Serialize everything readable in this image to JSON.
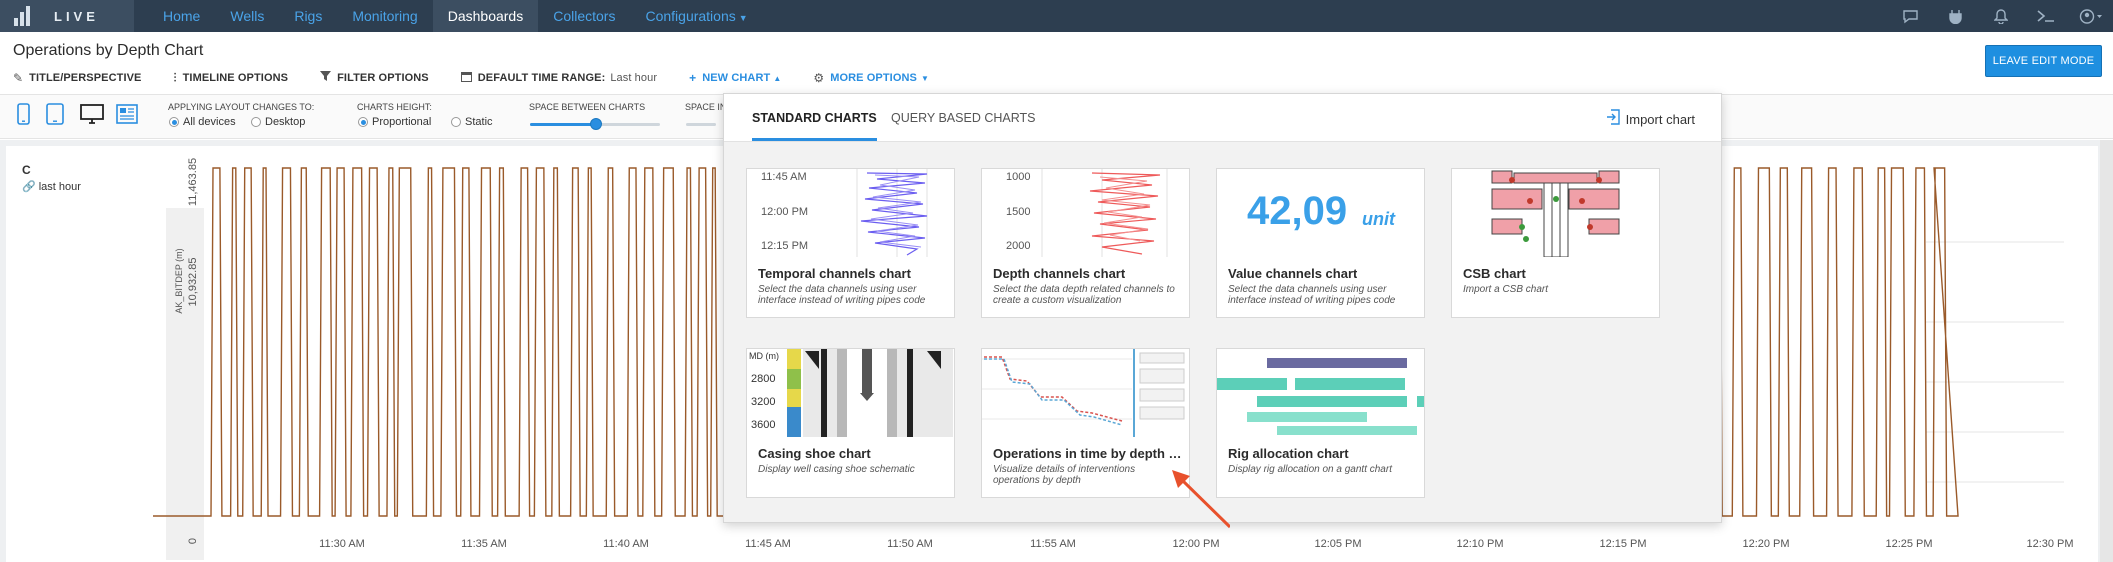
{
  "nav": {
    "brand": "LIVE",
    "items": [
      {
        "label": "Home"
      },
      {
        "label": "Wells"
      },
      {
        "label": "Rigs"
      },
      {
        "label": "Monitoring"
      },
      {
        "label": "Dashboards"
      },
      {
        "label": "Collectors"
      },
      {
        "label": "Configurations"
      }
    ],
    "right_icons": [
      "chat-icon",
      "plugin-icon",
      "bell-icon",
      "terminal-icon",
      "user-icon"
    ]
  },
  "page": {
    "title": "Operations by Depth Chart",
    "leave_button": "LEAVE EDIT MODE"
  },
  "toolbar": {
    "title_perspective": "TITLE/PERSPECTIVE",
    "timeline_options": "TIMELINE OPTIONS",
    "filter_options": "FILTER OPTIONS",
    "default_time_range": "DEFAULT TIME RANGE:",
    "default_time_value": "Last hour",
    "new_chart": "NEW CHART",
    "more_options": "MORE OPTIONS"
  },
  "layout": {
    "applying_label": "APPLYING LAYOUT CHANGES TO:",
    "all_devices": "All devices",
    "desktop": "Desktop",
    "charts_height": "CHARTS HEIGHT:",
    "proportional": "Proportional",
    "static": "Static",
    "space_between": "SPACE BETWEEN CHARTS",
    "space_in": "SPACE IN",
    "space_between_value": 0.5
  },
  "chart_panel": {
    "title": "C",
    "subtitle": "last hour"
  },
  "chart_data": {
    "type": "line",
    "title": "",
    "ylabel": "AK_BITDEP (m)",
    "y_ticks": [
      "0",
      "10,932.85",
      "11,463.85"
    ],
    "x_ticks": [
      "11:30 AM",
      "11:35 AM",
      "11:40 AM",
      "11:45 AM",
      "11:50 AM",
      "11:55 AM",
      "12:00 PM",
      "12:05 PM",
      "12:10 PM",
      "12:15 PM",
      "12:20 PM",
      "12:25 PM",
      "12:30 PM"
    ],
    "series_color": "#9a5a2a",
    "ylim": [
      0,
      11463.85
    ],
    "description": "single series oscillating rapidly between 0 and 11,463.85"
  },
  "dropdown": {
    "tab_standard": "STANDARD CHARTS",
    "tab_query": "QUERY BASED CHARTS",
    "import": "Import chart",
    "cards": [
      {
        "title": "Temporal channels chart",
        "desc": "Select the data channels using user interface instead of writing pipes code",
        "ticks": [
          "11:45 AM",
          "12:00 PM",
          "12:15 PM"
        ]
      },
      {
        "title": "Depth channels chart",
        "desc": "Select the data depth related channels to create a custom visualization",
        "ticks": [
          "1000",
          "1500",
          "2000"
        ]
      },
      {
        "title": "Value channels chart",
        "desc": "Select the data channels using user interface instead of writing pipes code",
        "value": "42,09",
        "unit": "unit"
      },
      {
        "title": "CSB chart",
        "desc": "Import a CSB chart"
      },
      {
        "title": "Casing shoe chart",
        "desc": "Display well casing shoe schematic",
        "ticks": [
          "MD (m)",
          "2800",
          "3200",
          "3600"
        ]
      },
      {
        "title": "Operations in time by depth chart",
        "desc": "Visualize details of interventions operations by depth"
      },
      {
        "title": "Rig allocation chart",
        "desc": "Display rig allocation on a gantt chart"
      }
    ]
  }
}
